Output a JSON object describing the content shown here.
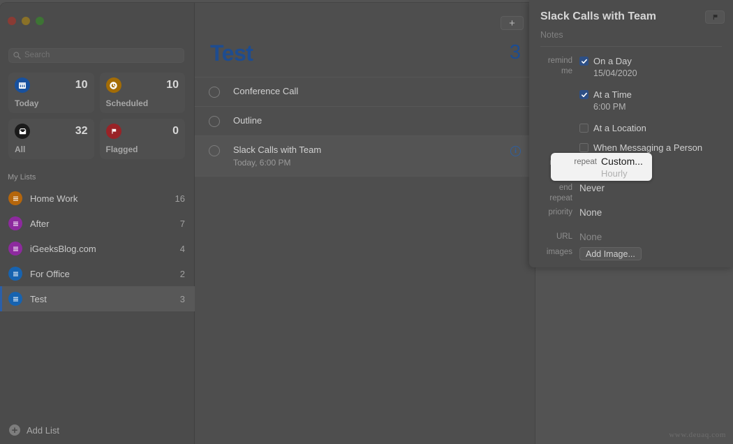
{
  "window": {
    "traffic_lights": [
      "close",
      "minimize",
      "zoom"
    ]
  },
  "sidebar": {
    "search": {
      "placeholder": "Search",
      "value": "",
      "icon": "search-icon"
    },
    "quick_access": [
      {
        "label": "Today",
        "count": "10",
        "icon": "calendar-icon",
        "color": "#18519e"
      },
      {
        "label": "Scheduled",
        "count": "10",
        "icon": "clock-icon",
        "color": "#a36c06"
      },
      {
        "label": "All",
        "count": "32",
        "icon": "inbox-icon",
        "color": "#1b1b1b"
      },
      {
        "label": "Flagged",
        "count": "0",
        "icon": "flag-icon",
        "color": "#992327"
      }
    ],
    "section_header": "My Lists",
    "lists": [
      {
        "label": "Home Work",
        "count": "16",
        "color": "#b5660c",
        "selected": false
      },
      {
        "label": "After",
        "count": "7",
        "color": "#8d2a9e",
        "selected": false
      },
      {
        "label": "iGeeksBlog.com",
        "count": "4",
        "color": "#8d2a9e",
        "selected": false
      },
      {
        "label": "For Office",
        "count": "2",
        "color": "#1763b0",
        "selected": false
      },
      {
        "label": "Test",
        "count": "3",
        "color": "#1763b0",
        "selected": true
      }
    ],
    "add_list_label": "Add List"
  },
  "main": {
    "add_button_icon": "plus-icon",
    "list_title": "Test",
    "list_count": "3",
    "accent_color": "#1e4c8f",
    "reminders": [
      {
        "title": "Conference Call",
        "subtitle": "",
        "selected": false,
        "has_info": false
      },
      {
        "title": "Outline",
        "subtitle": "",
        "selected": false,
        "has_info": false
      },
      {
        "title": "Slack Calls with Team",
        "subtitle": "Today, 6:00 PM",
        "selected": true,
        "has_info": true
      }
    ]
  },
  "detail": {
    "title": "Slack Calls with Team",
    "flag_icon": "flag-icon",
    "notes_placeholder": "Notes",
    "remind_me_label": "remind me",
    "on_a_day": {
      "label": "On a Day",
      "checked": true,
      "value": "15/04/2020"
    },
    "at_a_time": {
      "label": "At a Time",
      "checked": true,
      "value": "6:00 PM"
    },
    "at_a_location": {
      "label": "At a Location",
      "checked": false
    },
    "when_messaging": {
      "label": "When Messaging a Person",
      "checked": false
    },
    "repeat": {
      "label": "repeat",
      "value": "Custom...",
      "secondary": "Hourly"
    },
    "end_repeat": {
      "label": "end repeat",
      "value": "Never"
    },
    "priority": {
      "label": "priority",
      "value": "None"
    },
    "url": {
      "label": "URL",
      "value": "None"
    },
    "images": {
      "label": "images",
      "button": "Add Image..."
    }
  },
  "watermark": "www.deuaq.com"
}
